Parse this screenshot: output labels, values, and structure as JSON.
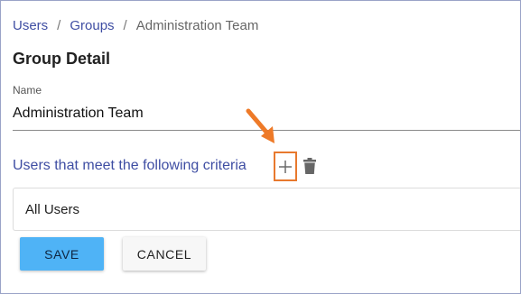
{
  "breadcrumb": {
    "items": [
      "Users",
      "Groups",
      "Administration Team"
    ],
    "separator": "/"
  },
  "page": {
    "title": "Group Detail"
  },
  "name_field": {
    "label": "Name",
    "value": "Administration Team"
  },
  "criteria": {
    "label": "Users that meet the following criteria",
    "add_icon": "plus-icon",
    "delete_icon": "trash-icon",
    "items": [
      "All Users"
    ]
  },
  "actions": {
    "save_label": "SAVE",
    "cancel_label": "CANCEL"
  },
  "colors": {
    "link": "#3f4ea3",
    "primary_button": "#4fb3f6",
    "highlight": "#e8792e"
  }
}
